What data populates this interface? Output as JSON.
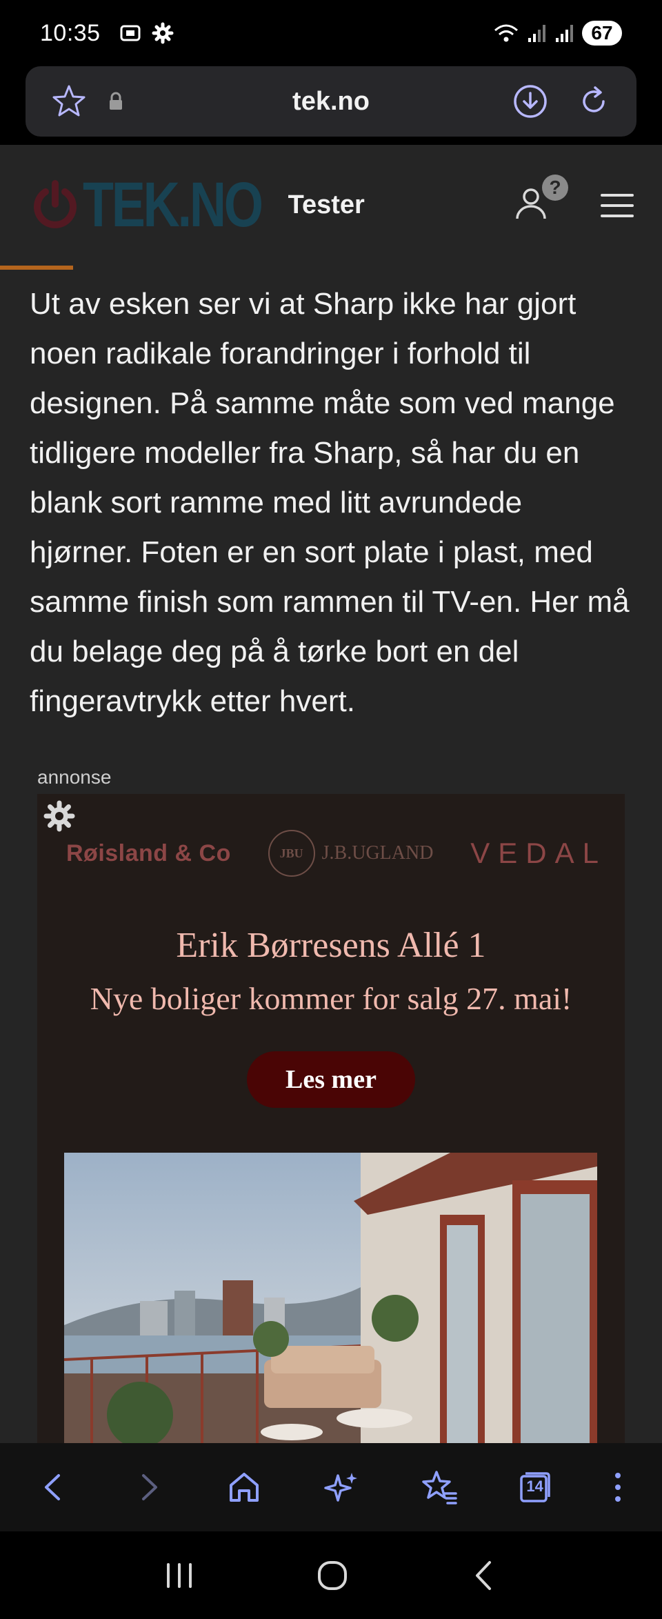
{
  "status_bar": {
    "time": "10:35",
    "battery": "67",
    "icons": [
      "screenshot-icon",
      "settings-gear-icon",
      "wifi-icon",
      "signal-icon",
      "signal-icon"
    ]
  },
  "browser": {
    "url": "tek.no"
  },
  "site": {
    "logo_text": "TEK.NO",
    "nav_label": "Tester",
    "account_badge": "?"
  },
  "article": {
    "paragraph": "Ut av esken ser vi at Sharp ikke har gjort noen radikale forandringer i forhold til designen. På samme måte som ved mange tidligere modeller fra Sharp, så har du en blank sort ramme med litt avrundede hjørner. Foten er en sort plate i plast, med samme finish som rammen til TV-en. Her må du belage deg på å tørke bort en del fingeravtrykk etter hvert."
  },
  "ad": {
    "label": "annonse",
    "brand_1": "Røisland & Co",
    "brand_2_seal": "JBU",
    "brand_2": "J.B.UGLAND",
    "brand_3": "VEDAL",
    "title": "Erik Børresens Allé 1",
    "subtitle": "Nye boliger kommer for salg 27. mai!",
    "button": "Les mer"
  },
  "toolbar": {
    "tab_count": "14"
  },
  "colors": {
    "page_bg": "#252525",
    "accent_blue": "#8fa0ff",
    "ad_text": "#f0b9ae",
    "ad_button": "#4a0505"
  }
}
